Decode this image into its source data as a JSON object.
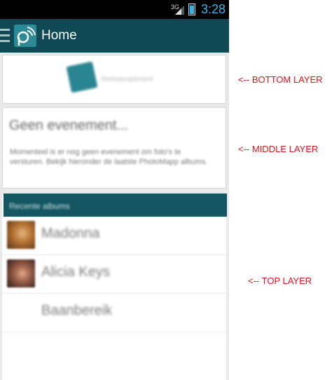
{
  "statusbar": {
    "network": "3G",
    "time": "3:28"
  },
  "actionbar": {
    "title": "Home"
  },
  "banner": {
    "logo_text": "Websiteoptiment"
  },
  "event": {
    "title": "Geen evenement...",
    "body": "Momenteel is er nog geen evenement om foto's te versturen. Bekijk hieronder de laatste PhotoMapp albums."
  },
  "albums": {
    "header": "Recente albums",
    "items": [
      {
        "name": "Madonna"
      },
      {
        "name": "Alicia Keys"
      },
      {
        "name": "Baanbereik"
      }
    ]
  },
  "annotations": {
    "bottom": "<-- BOTTOM LAYER",
    "middle": "<-- MIDDLE LAYER",
    "top": "<-- TOP LAYER"
  },
  "colors": {
    "accent": "#0e4955",
    "status_time": "#33b5e5",
    "annotation": "#e8101a"
  },
  "icons": [
    "signal-icon",
    "battery-icon",
    "menu-icon",
    "app-logo-icon",
    "banner-logo-icon"
  ]
}
